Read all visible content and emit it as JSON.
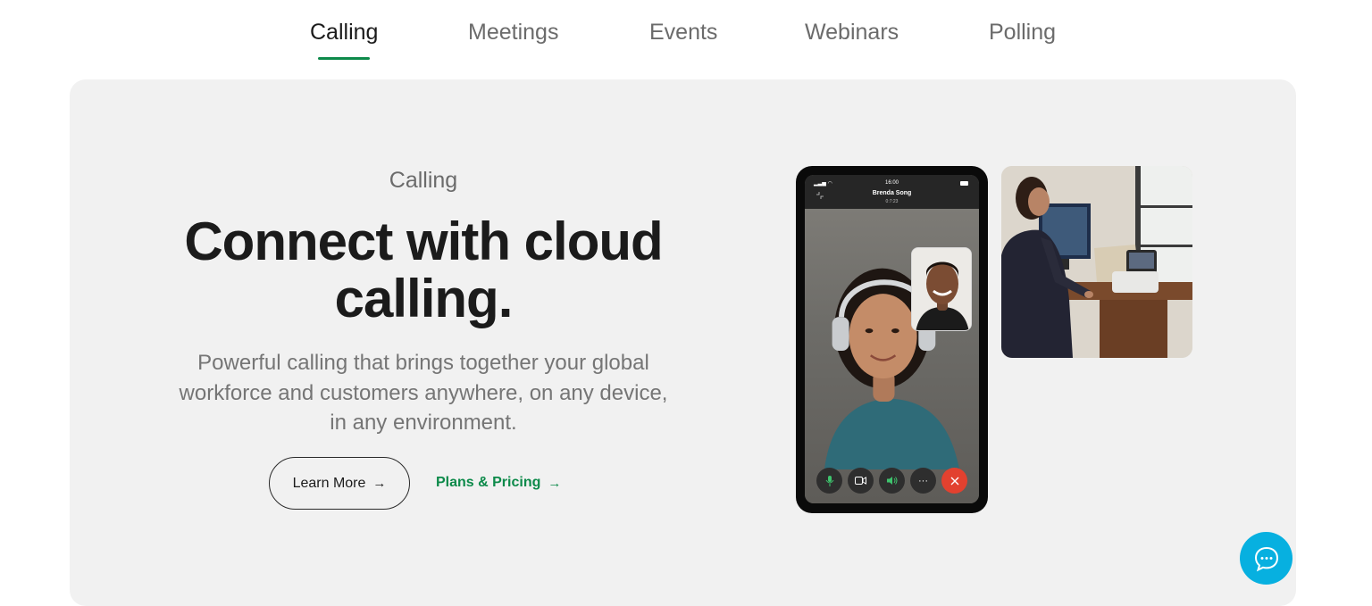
{
  "tabs": [
    {
      "label": "Calling",
      "active": true
    },
    {
      "label": "Meetings",
      "active": false
    },
    {
      "label": "Events",
      "active": false
    },
    {
      "label": "Webinars",
      "active": false
    },
    {
      "label": "Polling",
      "active": false
    }
  ],
  "hero": {
    "eyebrow": "Calling",
    "headline": "Connect with cloud calling.",
    "subtext": "Powerful calling that brings together your global workforce and customers anywhere, on any device, in any environment.",
    "learn_more_label": "Learn More",
    "plans_label": "Plans & Pricing",
    "arrow": "→"
  },
  "phone": {
    "time": "16:00",
    "caller_name": "Brenda Song",
    "call_duration": "0:7:23"
  },
  "colors": {
    "accent_green": "#0d8a4a",
    "hero_bg": "#f1f1f1",
    "chat_blue": "#07b0e0",
    "end_call_red": "#e2412f"
  },
  "icons": {
    "chat": "chat-bubble-icon",
    "mic": "microphone-icon",
    "video": "video-camera-icon",
    "speaker": "speaker-icon",
    "more": "more-dots-icon",
    "end": "end-call-icon"
  }
}
